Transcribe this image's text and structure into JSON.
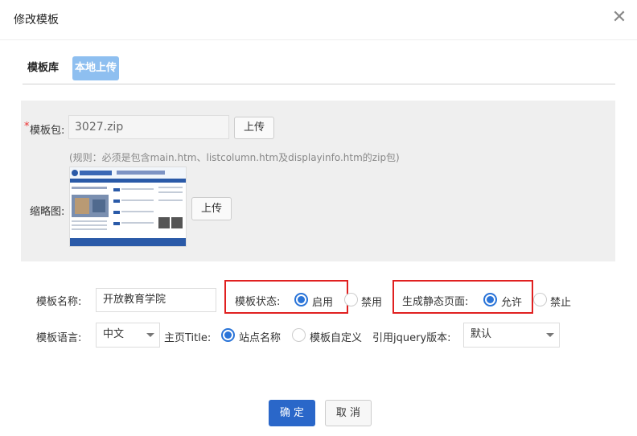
{
  "dialog": {
    "title": "修改模板"
  },
  "tabs": [
    {
      "label": "模板库",
      "active": false
    },
    {
      "label": "本地上传",
      "active": true
    }
  ],
  "upload": {
    "package_label": "模板包:",
    "package_value": "3027.zip",
    "upload_button": "上传",
    "rule_hint": "(规则：必须是包含main.htm、listcolumn.htm及displayinfo.htm的zip包)",
    "thumb_label": "缩略图:",
    "thumb_upload_button": "上传"
  },
  "form": {
    "name_label": "模板名称:",
    "name_value": "开放教育学院",
    "status_label": "模板状态:",
    "status_options": [
      "启用",
      "禁用"
    ],
    "status_selected": "启用",
    "static_label": "生成静态页面:",
    "static_options": [
      "允许",
      "禁止"
    ],
    "static_selected": "允许",
    "lang_label": "模板语言:",
    "lang_value": "中文",
    "title_label": "主页Title:",
    "title_options": [
      "站点名称",
      "模板自定义"
    ],
    "title_selected": "站点名称",
    "jquery_label": "引用jquery版本:",
    "jquery_value": "默认"
  },
  "footer": {
    "ok": "确 定",
    "cancel": "取 消"
  },
  "colors": {
    "primary": "#2a67c9",
    "radio_on": "#2a74d8",
    "highlight_box": "#e02020",
    "tab_active": "#8ebff0"
  }
}
